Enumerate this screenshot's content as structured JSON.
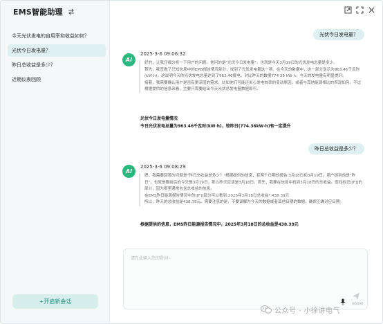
{
  "app": {
    "title": "EMS智能助理"
  },
  "sidebar": {
    "conversations": [
      {
        "label": "今天光伏发电的自用率和收益如何？"
      },
      {
        "label": "光伏今日发电量？"
      },
      {
        "label": "昨日总收益是多少？"
      },
      {
        "label": "近期仪表回顾"
      }
    ],
    "active_index": 1,
    "new_chat_label": "+开启新会话"
  },
  "messages": {
    "q1": "光伏今日发电量？",
    "a1": {
      "timestamp": "2025-3-6 09:06:32",
      "think": [
        "好的，让我仔细分析一下用户的问题。他问的是\"光伏今日发电量\"，也就是今天3月19日的光伏发电总量是多少。",
        "首先，我查看了已知信息中的EMS报告情况部分，找到了光伏发电量这一项。在今天的数据中，这一部分显示为963.46千瓦时(kW·h)。这说明今天的光伏发电总量达到了963.46度电。对比昨天的数据774.36 kW·h，今天的发电量有明显提升。",
        "接着，我需要确认用户是否有更深层的需求。比如他们可能还关心发电效率的变动原因，或者与其他能源相比的表现如何。不过根据提供的信息来看，主要只需要给出今天光伏总发电量数据即可。"
      ],
      "answer_title": "光伏今日发电量情况",
      "answer_body": "今日光伏发电总量为963.46千瓦时(kW·h)，较昨日(774.36kW·h)有一定提升"
    },
    "q2": "昨日总收益是多少？",
    "a2": {
      "timestamp": "2025-3-6 09:08:29",
      "think": [
        "嗯，我需要回答的问题是\"昨日总收益是多少？\"根据提供的信息，有两个日期的报告:3月18日和3月19日。用户提到的是\"昨日\"，也就是要前后的今天是3月19日，那么昨天应该是3月18日。首先，我要在信息中找到3月18日的总收益。查找标记[[F]]的部分，因为那里通常包含总收益的信息。",
        "在EMS昨日能源报告情况中的[[F]]部分可以看到:2025年3月18日总收益*:438.39元",
        "所以，昨天的总收益是438.39元。需要注意的是，不要误解为今天的数据或者其他日期的数据，确保正确对应日期。"
      ],
      "answer_body": "根据提供的信息，EMS昨日能源报告情况中，2025年3月18日的总收益是438.39元"
    }
  },
  "composer": {
    "placeholder": "请在此输入您的提问~",
    "value": "",
    "counter": "0/1000"
  },
  "watermark": {
    "text": "公众号 · 小徐讲电气"
  },
  "icons": {
    "brand": "swap-icon",
    "window": [
      "expand-icon",
      "fullscreen-icon",
      "close-icon"
    ],
    "avatar": "ai-avatar-icon",
    "send": "send-icon",
    "mic": "mic-icon",
    "avatar_text": "AI"
  },
  "colors": {
    "accent": "#2bb87e",
    "bubble": "#dff0f2",
    "new_chat_bg": "#d6efec",
    "new_chat_text": "#1f8a7a"
  }
}
